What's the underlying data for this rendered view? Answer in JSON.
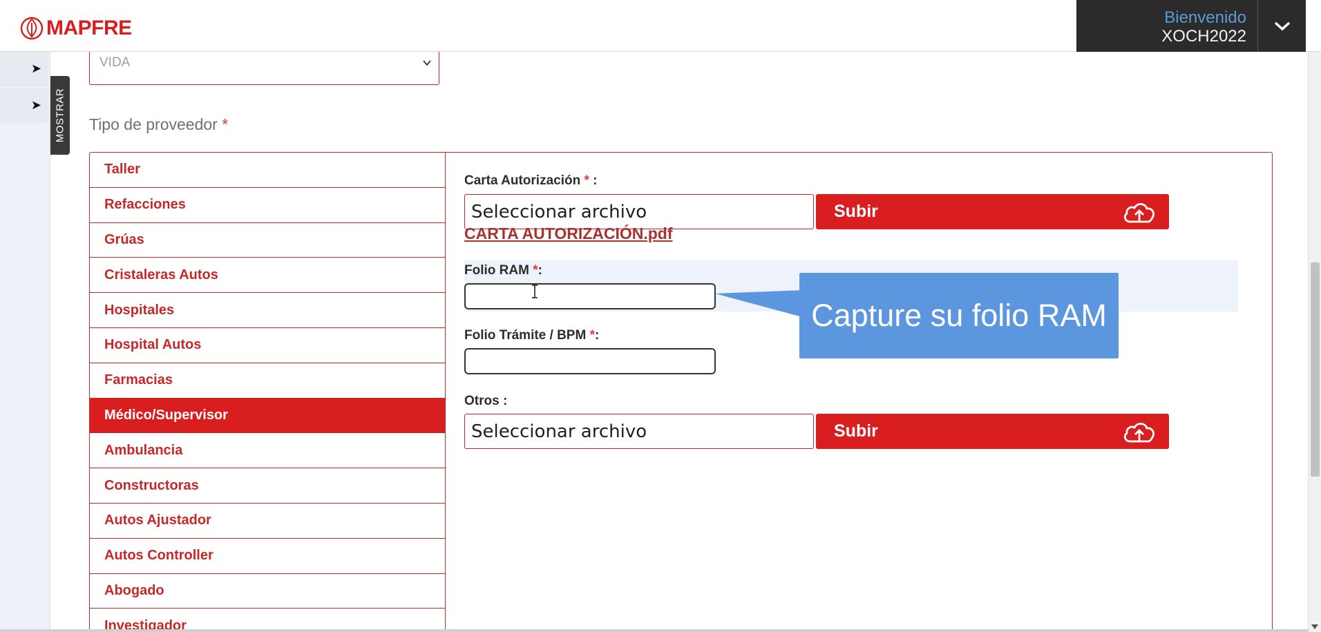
{
  "header": {
    "brand": "MAPFRE",
    "welcome": "Bienvenido",
    "username": "XOCH2022"
  },
  "sidebar": {
    "toggle_label": "MOSTRAR"
  },
  "form": {
    "ramo_select_value": "VIDA",
    "tipo_label": "Tipo de proveedor",
    "required_mark": "*",
    "carta_label": "Carta Autorización",
    "carta_file_placeholder": "Seleccionar archivo",
    "carta_uploaded_file": "CARTA AUTORIZACIÓN.pdf",
    "folio_ram_label": "Folio RAM",
    "folio_ram_value": "",
    "folio_tramite_label": "Folio Trámite / BPM",
    "folio_tramite_value": "",
    "otros_label": "Otros :",
    "otros_file_placeholder": "Seleccionar archivo",
    "upload_button_label": "Subir",
    "colon_space": " :",
    "colon": ":"
  },
  "providers": [
    "Taller",
    "Refacciones",
    "Grúas",
    "Cristaleras Autos",
    "Hospitales",
    "Hospital Autos",
    "Farmacias",
    "Médico/Supervisor",
    "Ambulancia",
    "Constructoras",
    "Autos Ajustador",
    "Autos Controller",
    "Abogado",
    "Investigador"
  ],
  "active_provider": "Médico/Supervisor",
  "tooltip": {
    "text": "Capture su folio RAM"
  },
  "colors": {
    "brand_red": "#d81e1e",
    "border_red": "#c62828",
    "tooltip_blue": "#5b96df",
    "header_dark": "#2b2b2b",
    "welcome_blue": "#5b9bd5"
  }
}
